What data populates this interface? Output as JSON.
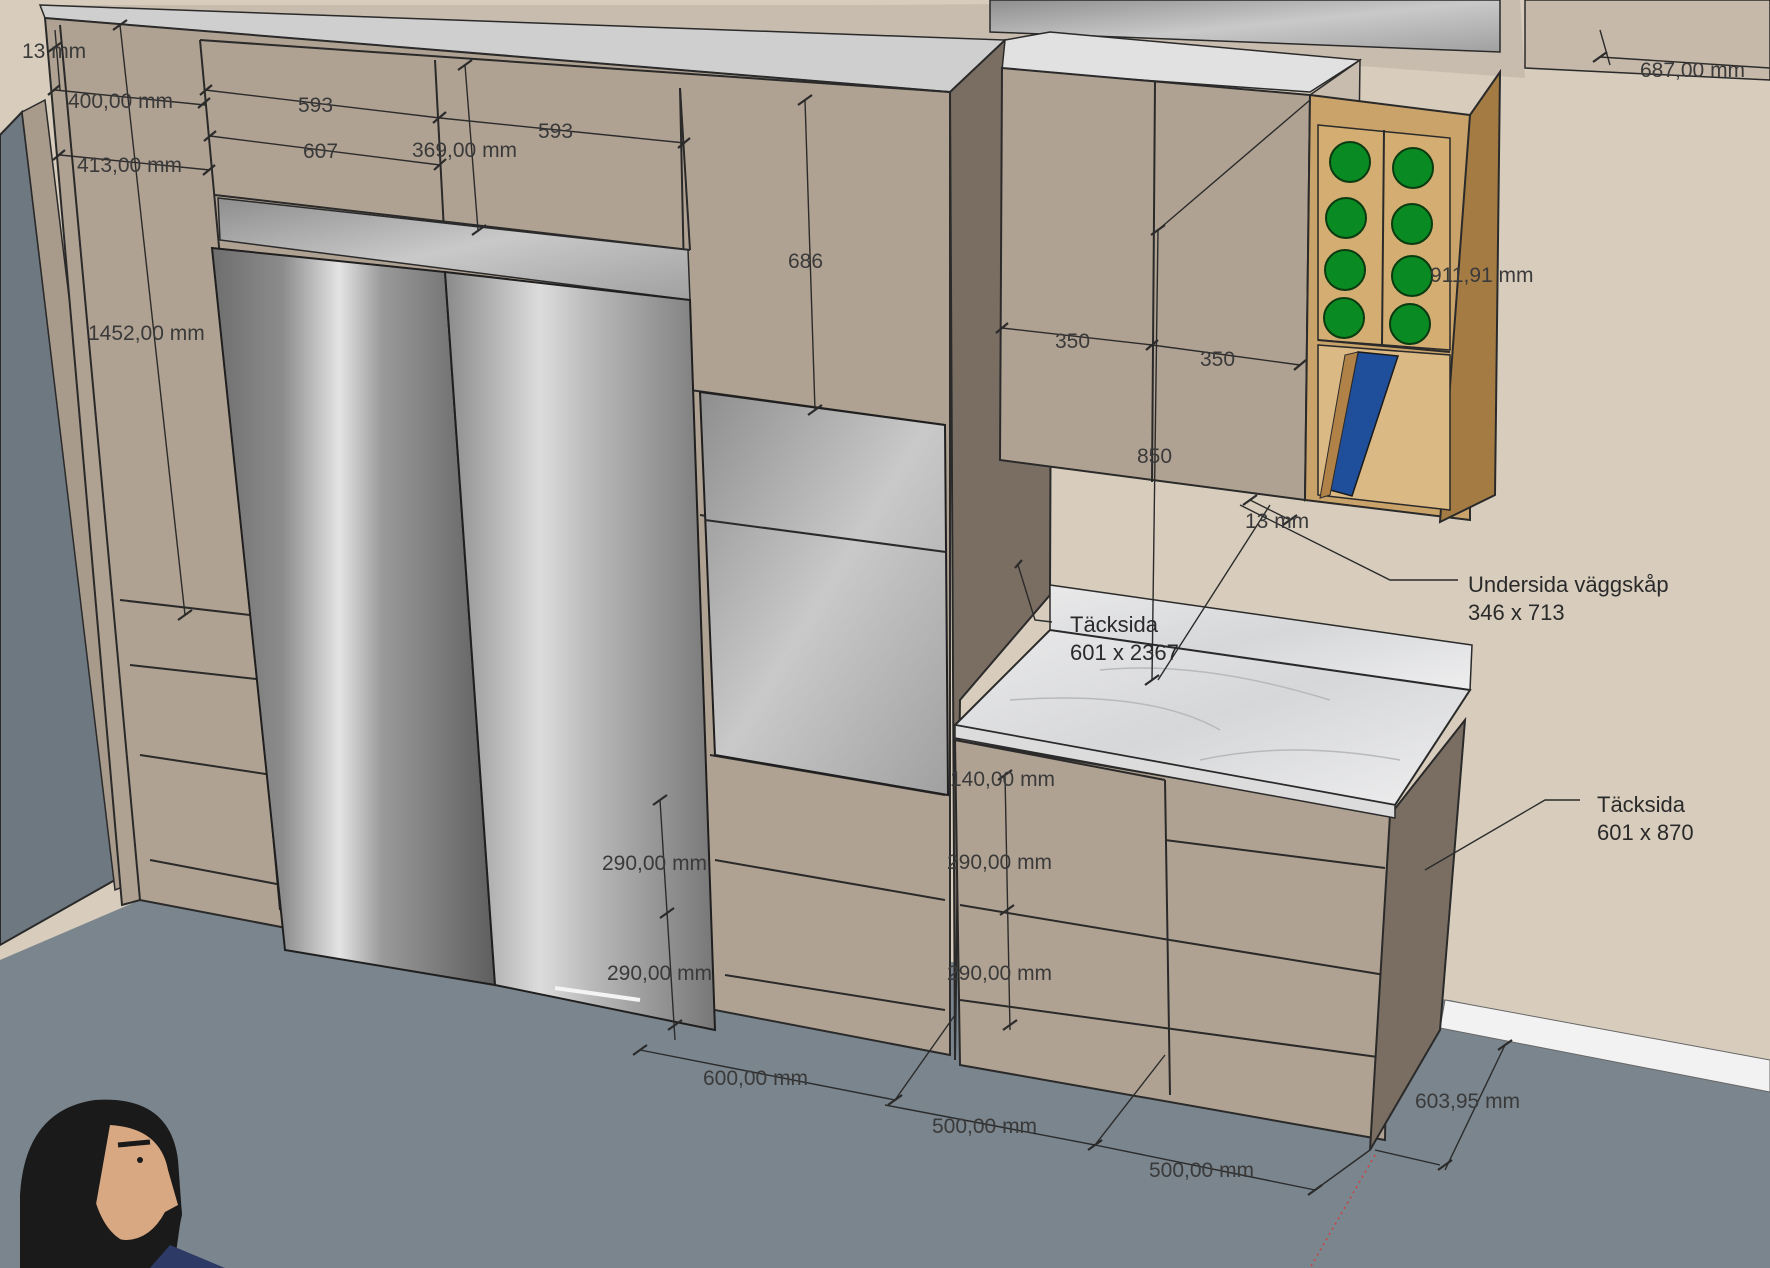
{
  "dimensions": {
    "d_13_top": "13 mm",
    "d_400": "400,00 mm",
    "d_413": "413,00 mm",
    "d_593_a": "593",
    "d_607": "607",
    "d_593_b": "593",
    "d_369": "369,00 mm",
    "d_686": "686",
    "d_1452": "1452,00 mm",
    "d_687": "687,00 mm",
    "d_911": "911,91 mm",
    "d_350_a": "350",
    "d_350_b": "350",
    "d_850": "850",
    "d_13_bottom": "13 mm",
    "d_140": "140,00 mm",
    "d_290_a": "290,00 mm",
    "d_290_b": "290,00 mm",
    "d_290_c": "290,00 mm",
    "d_290_d": "290,00 mm",
    "d_600": "600,00 mm",
    "d_500_a": "500,00 mm",
    "d_500_b": "500,00 mm",
    "d_603": "603,95 mm"
  },
  "annotations": {
    "underside_title": "Undersida väggskåp",
    "underside_size": "346 x 713",
    "cover_tall_title": "Täcksida",
    "cover_tall_size": "601 x 2367",
    "cover_base_title": "Täcksida",
    "cover_base_size": "601 x 870"
  },
  "colors": {
    "wall": "#d8cdbd",
    "floor": "#7a858d",
    "cabinet": "#b0a292",
    "cabinet_dark": "#7a6e62",
    "steel": "#9a9a9a",
    "wine_green": "#0a7a1a",
    "wood": "#c9a36a",
    "door_left": "#6e7880"
  },
  "icons": [
    "avatar-icon"
  ]
}
